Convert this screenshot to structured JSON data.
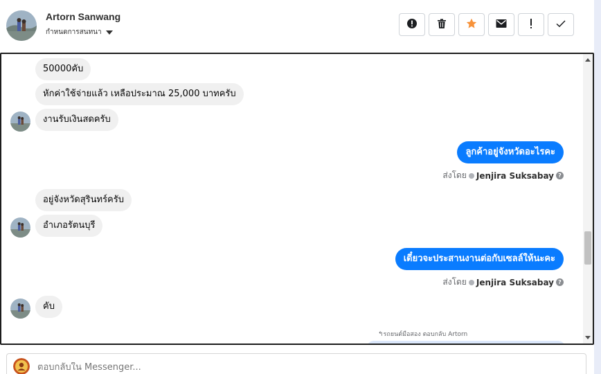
{
  "header": {
    "contact_name": "Artorn Sanwang",
    "conversation_status": "กำหนดการสนทนา",
    "toolbar": [
      {
        "name": "spam-button",
        "icon": "alert-circle-icon"
      },
      {
        "name": "delete-button",
        "icon": "trash-icon"
      },
      {
        "name": "star-button",
        "icon": "star-icon",
        "color": "#f7923a"
      },
      {
        "name": "mark-unread-button",
        "icon": "envelope-icon"
      },
      {
        "name": "follow-up-button",
        "icon": "exclamation-icon"
      },
      {
        "name": "mark-done-button",
        "icon": "check-icon"
      }
    ]
  },
  "messages": {
    "m1": "50000คับ",
    "m2": "หักค่าใช้จ่ายแล้ว เหลือประมาณ 25,000 บาทครับ",
    "m3": "งานรับเงินสดครับ",
    "m4": "ลูกค้าอยู่จังหวัดอะไรคะ",
    "m5": "อยู่จังหวัดสุรินทร์ครับ",
    "m6": "อำเภอรัตนบุรี",
    "m7": "เดี๋ยวจะประสานงานต่อกับเซลล์ให้นะคะ",
    "m8": "คับ"
  },
  "sent_by": {
    "label": "ส่งโดย",
    "agent": "Jenjira Suksabay"
  },
  "reply_note": "↰รถยนต์มือสอง ตอบกลับ Artorn",
  "composer": {
    "placeholder": "ตอบกลับใน Messenger..."
  },
  "colors": {
    "outgoing_bubble": "#0a7cff",
    "incoming_bubble": "#f0f0f0",
    "star": "#f7923a"
  }
}
